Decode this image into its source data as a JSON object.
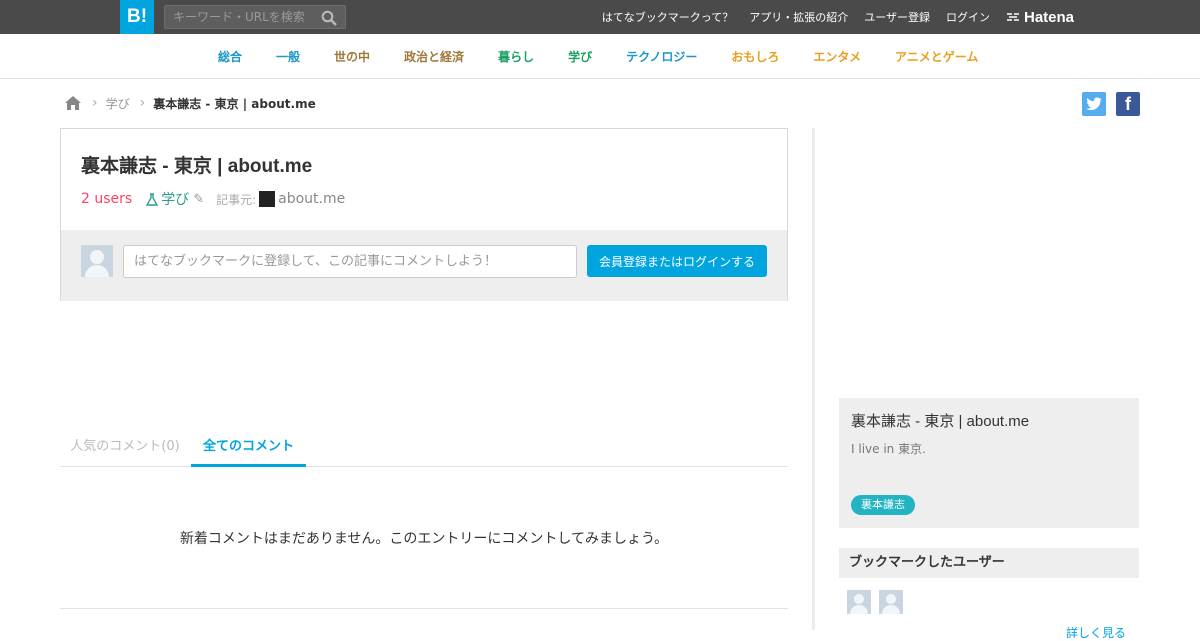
{
  "header": {
    "logo": "B!",
    "search_placeholder": "キーワード・URLを検索",
    "links": [
      "はてなブックマークって？",
      "アプリ・拡張の紹介",
      "ユーザー登録",
      "ログイン"
    ],
    "brand": "Hatena"
  },
  "categories": [
    {
      "label": "総合",
      "color": "#1e96c8"
    },
    {
      "label": "一般",
      "color": "#1e96c8"
    },
    {
      "label": "世の中",
      "color": "#a0783c"
    },
    {
      "label": "政治と経済",
      "color": "#a0783c"
    },
    {
      "label": "暮らし",
      "color": "#1ea064"
    },
    {
      "label": "学び",
      "color": "#1ea064"
    },
    {
      "label": "テクノロジー",
      "color": "#1e96c8"
    },
    {
      "label": "おもしろ",
      "color": "#e6a01e"
    },
    {
      "label": "エンタメ",
      "color": "#e6a01e"
    },
    {
      "label": "アニメとゲーム",
      "color": "#e6a01e"
    }
  ],
  "breadcrumb": {
    "category": "学び",
    "current": "裏本謙志 - 東京 | about.me"
  },
  "share": {
    "twitter": "t",
    "facebook": "f"
  },
  "entry": {
    "title": "裏本謙志 - 東京 | about.me",
    "users": "2 users",
    "category": "学び",
    "source_label": "記事元:",
    "source": "about.me",
    "comment_placeholder": "はてなブックマークに登録して、この記事にコメントしよう！",
    "login_button": "会員登録またはログインする"
  },
  "tabs": {
    "popular": "人気のコメント(0)",
    "all": "全てのコメント"
  },
  "no_comments": "新着コメントはまだありません。このエントリーにコメントしてみましょう。",
  "sidebar": {
    "card_title": "裏本謙志 - 東京 | about.me",
    "card_desc": "I live in 東京.",
    "tag": "裏本謙志",
    "bookmark_header": "ブックマークしたユーザー",
    "more_link": "詳しく見る"
  },
  "colors": {
    "accent": "#00a4de",
    "users": "#ff4166",
    "topbar": "#4a4a4a"
  }
}
